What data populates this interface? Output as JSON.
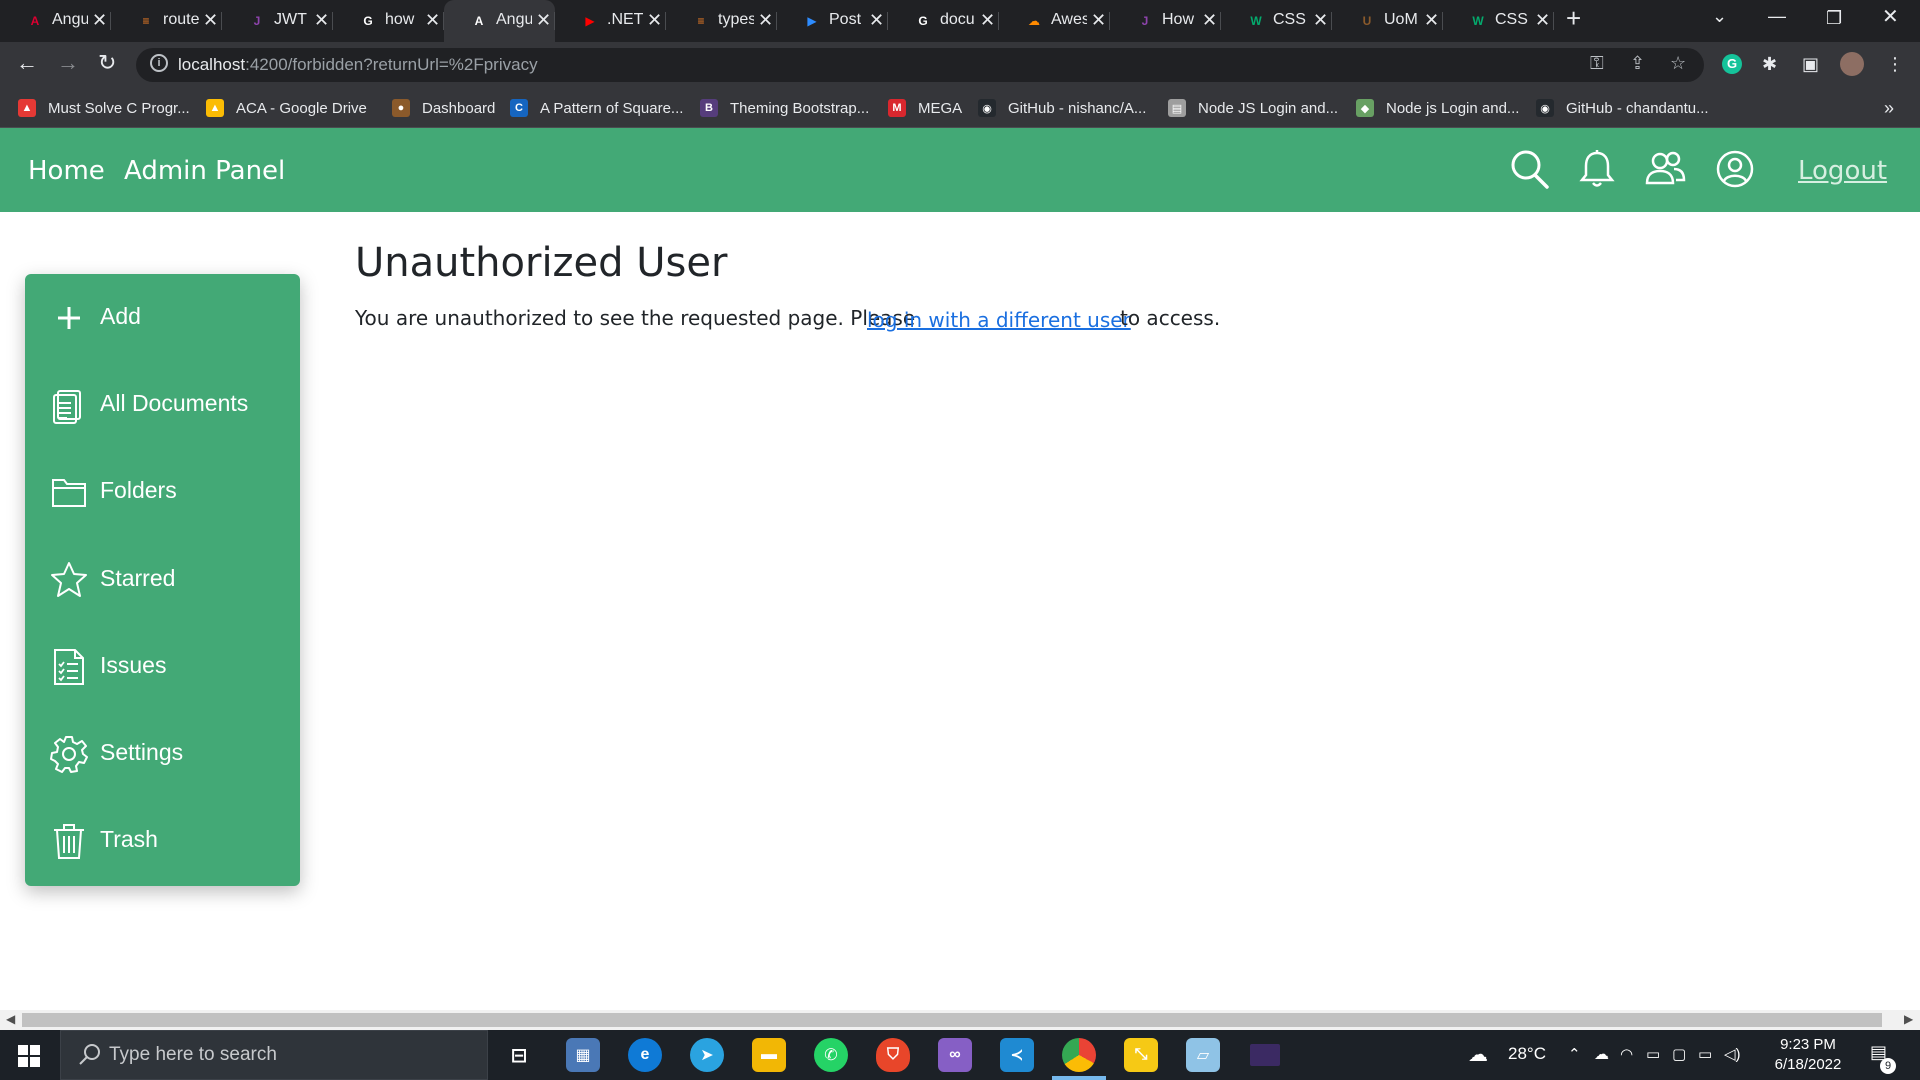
{
  "browser": {
    "tabs": [
      {
        "title": "Angu",
        "icon": "angular-icon",
        "color": "#dd0031",
        "glyph": "A"
      },
      {
        "title": "route",
        "icon": "stackoverflow-icon",
        "color": "#f48024",
        "glyph": "≡"
      },
      {
        "title": "JWT",
        "icon": "jwt-icon",
        "color": "#8e44ad",
        "glyph": "J"
      },
      {
        "title": "how",
        "icon": "google-icon",
        "color": "#ffffff",
        "glyph": "G"
      },
      {
        "title": "Angu",
        "icon": "angular-icon",
        "color": "#ffffff",
        "glyph": "A",
        "active": true
      },
      {
        "title": ".NET",
        "icon": "youtube-icon",
        "color": "#ff0000",
        "glyph": "▶"
      },
      {
        "title": "types",
        "icon": "stackoverflow-icon",
        "color": "#f48024",
        "glyph": "≡"
      },
      {
        "title": "Post",
        "icon": "zoom-icon",
        "color": "#2d8cff",
        "glyph": "▶"
      },
      {
        "title": "docu",
        "icon": "google-icon",
        "color": "#ffffff",
        "glyph": "G"
      },
      {
        "title": "Awes",
        "icon": "cloud-icon",
        "color": "#ff8a00",
        "glyph": "☁"
      },
      {
        "title": "How",
        "icon": "jwt-icon",
        "color": "#8e44ad",
        "glyph": "J"
      },
      {
        "title": "CSS l",
        "icon": "w3schools-icon",
        "color": "#04aa6d",
        "glyph": "W"
      },
      {
        "title": "UoM",
        "icon": "uom-icon",
        "color": "#8b5a2b",
        "glyph": "U"
      },
      {
        "title": "CSS",
        "icon": "w3schools-icon",
        "color": "#04aa6d",
        "glyph": "W"
      }
    ],
    "url_host": "localhost",
    "url_rest": ":4200/forbidden?returnUrl=%2Fprivacy",
    "bookmarks": [
      {
        "label": "Must Solve C Progr...",
        "icon": "pdf-icon",
        "color": "#e53935",
        "glyph": "▲"
      },
      {
        "label": "ACA - Google Drive",
        "icon": "drive-icon",
        "color": "#fbbc04",
        "glyph": "▲"
      },
      {
        "label": "Dashboard",
        "icon": "dashboard-icon",
        "color": "#8b5a2b",
        "glyph": "●"
      },
      {
        "label": "A Pattern of Square...",
        "icon": "c-icon",
        "color": "#1565c0",
        "glyph": "C"
      },
      {
        "label": "Theming Bootstrap...",
        "icon": "bootstrap-icon",
        "color": "#563d7c",
        "glyph": "B"
      },
      {
        "label": "MEGA",
        "icon": "mega-icon",
        "color": "#d9272e",
        "glyph": "M"
      },
      {
        "label": "GitHub - nishanc/A...",
        "icon": "github-icon",
        "color": "#24292e",
        "glyph": "◉"
      },
      {
        "label": "Node JS Login and...",
        "icon": "page-icon",
        "color": "#9e9e9e",
        "glyph": "▤"
      },
      {
        "label": "Node js Login and...",
        "icon": "node-icon",
        "color": "#68a063",
        "glyph": "◆"
      },
      {
        "label": "GitHub - chandantu...",
        "icon": "github-icon",
        "color": "#24292e",
        "glyph": "◉"
      }
    ],
    "more_bookmarks": "»"
  },
  "app": {
    "accent_color": "#43a976",
    "nav": {
      "home": "Home",
      "admin": "Admin Panel",
      "logout": "Logout"
    },
    "sidebar": [
      {
        "label": "Add",
        "icon": "plus-icon"
      },
      {
        "label": "All Documents",
        "icon": "documents-icon"
      },
      {
        "label": "Folders",
        "icon": "folder-icon"
      },
      {
        "label": "Starred",
        "icon": "star-icon"
      },
      {
        "label": "Issues",
        "icon": "checklist-icon"
      },
      {
        "label": "Settings",
        "icon": "gear-icon"
      },
      {
        "label": "Trash",
        "icon": "trash-icon"
      }
    ],
    "title": "Unauthorized User",
    "message_before": "You are unauthorized to see the requested page. Please",
    "message_link": "log in with a different user",
    "message_after": "to access.",
    "link_color": "#1a6fe0"
  },
  "taskbar": {
    "search_placeholder": "Type here to search",
    "temperature": "28°C",
    "time": "9:23 PM",
    "date": "6/18/2022",
    "notification_count": "9"
  }
}
